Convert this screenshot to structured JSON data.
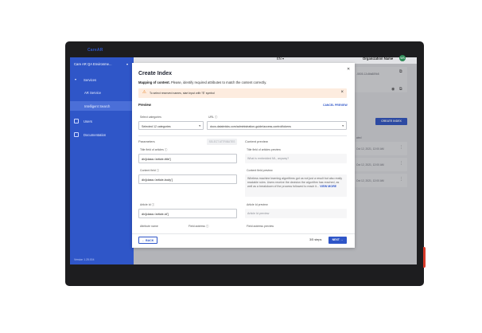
{
  "app": {
    "logo": "CareAR",
    "environment": "Care AR QA Environme...",
    "version": "Version 1.25.004",
    "language": "EN",
    "organization": "Organization Name",
    "avatar_initials": "WS"
  },
  "sidebar": {
    "items": [
      {
        "label": "Services",
        "icon": "chevron-down-icon"
      },
      {
        "label": "AR Service",
        "icon": ""
      },
      {
        "label": "Intelligent Search",
        "icon": ""
      },
      {
        "label": "Users",
        "icon": "users-icon"
      },
      {
        "label": "Documentation",
        "icon": "document-icon"
      }
    ]
  },
  "background": {
    "id_text": "-5505-12c8fa889b8",
    "create_index_label": "CREATE INDEX",
    "column_header": "ated",
    "dates": [
      "Oct 12, 2021, 12:00 AM",
      "Oct 12, 2021, 12:00 AM",
      "Oct 12, 2021, 12:00 AM"
    ]
  },
  "modal": {
    "title": "Create Index",
    "subtitle_bold": "Mapping of content.",
    "subtitle_rest": " Please, identify required attributes to match the content correctly.",
    "alert_text": "To select reserved names, start input with \"$\" symbol",
    "preview_label": "Preview",
    "cancel_preview": "CANCEL PREVIEW",
    "categories_caption": "Select categories",
    "categories_value": "Selected 12 categories",
    "url_caption": "URL",
    "url_value": "docs.databricks.com/administration-guide/access-control/tokens",
    "parameters_title": "Parameters",
    "select_attributes": "SELECT ATTRIBUTES",
    "content_preview_title": "Content preview",
    "fields": [
      {
        "caption": "Title field of articles",
        "value": "div[class='article-title']"
      },
      {
        "caption": "Content field",
        "value": "div[class='article-body']"
      },
      {
        "caption": "Article Id",
        "value": "div[class='article-id']"
      }
    ],
    "attribute_name_caption": "Attribute name",
    "field_address_caption": "Field address",
    "previews": [
      {
        "caption": "Title field of articles preview",
        "value": "What is embedded ML, anyway?"
      },
      {
        "caption": "Content field preview",
        "value": "Wireless machine learning algorithms got us not just a result but also really readable rules. Users receive the decision the algorithm has reached, as well as a breakdown of the process followed to reach it..."
      },
      {
        "caption": "Article Id preview",
        "value": "Article Id preview"
      },
      {
        "caption": "Field address preview",
        "value": ""
      }
    ],
    "view_more": "VIEW MORE",
    "back_label": "BACK",
    "steps": "3/5 steps",
    "next_label": "NEXT"
  },
  "colors": {
    "primary": "#2f56c8",
    "alert_bg": "#fdecdf",
    "warning": "#e7811f",
    "device": "#1d1d1f",
    "accent_button": "#d83b2b"
  }
}
